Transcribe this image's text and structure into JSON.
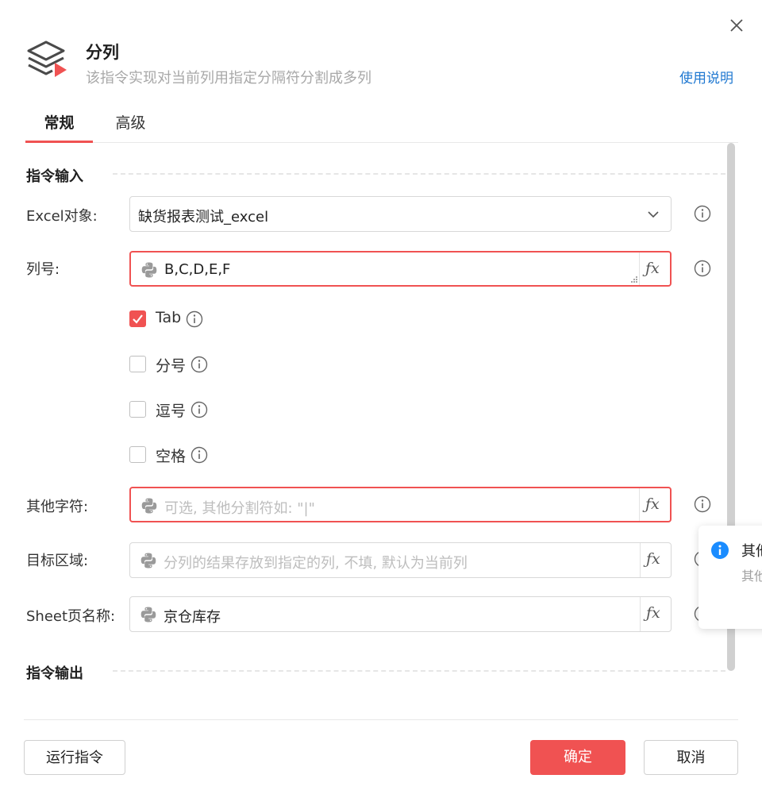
{
  "header": {
    "title": "分列",
    "subtitle": "该指令实现对当前列用指定分隔符分割成多列",
    "help_link": "使用说明",
    "icon": "layers-play-icon"
  },
  "tabs": [
    {
      "label": "常规",
      "active": true
    },
    {
      "label": "高级",
      "active": false
    }
  ],
  "sections": {
    "input": "指令输入",
    "output": "指令输出"
  },
  "fields": {
    "excel_object": {
      "label": "Excel对象:",
      "value": "缺货报表测试_excel"
    },
    "column": {
      "label": "列号:",
      "value": "B,C,D,E,F"
    },
    "other_chars": {
      "label": "其他字符:",
      "placeholder": "可选, 其他分割符如: \"|\""
    },
    "target_area": {
      "label": "目标区域:",
      "placeholder": "分列的结果存放到指定的列, 不填, 默认为当前列"
    },
    "sheet_name": {
      "label": "Sheet页名称:",
      "value": "京仓库存"
    }
  },
  "fx_label": "ƒx",
  "checkboxes": [
    {
      "label": "Tab",
      "checked": true
    },
    {
      "label": "分号",
      "checked": false
    },
    {
      "label": "逗号",
      "checked": false
    },
    {
      "label": "空格",
      "checked": false
    }
  ],
  "tooltip": {
    "title": "其他字符",
    "subtitle": "其他分割符"
  },
  "buttons": {
    "run": "运行指令",
    "ok": "确定",
    "cancel": "取消"
  },
  "colors": {
    "accent": "#f05252",
    "link": "#1f78d1",
    "info": "#1a8cff"
  }
}
